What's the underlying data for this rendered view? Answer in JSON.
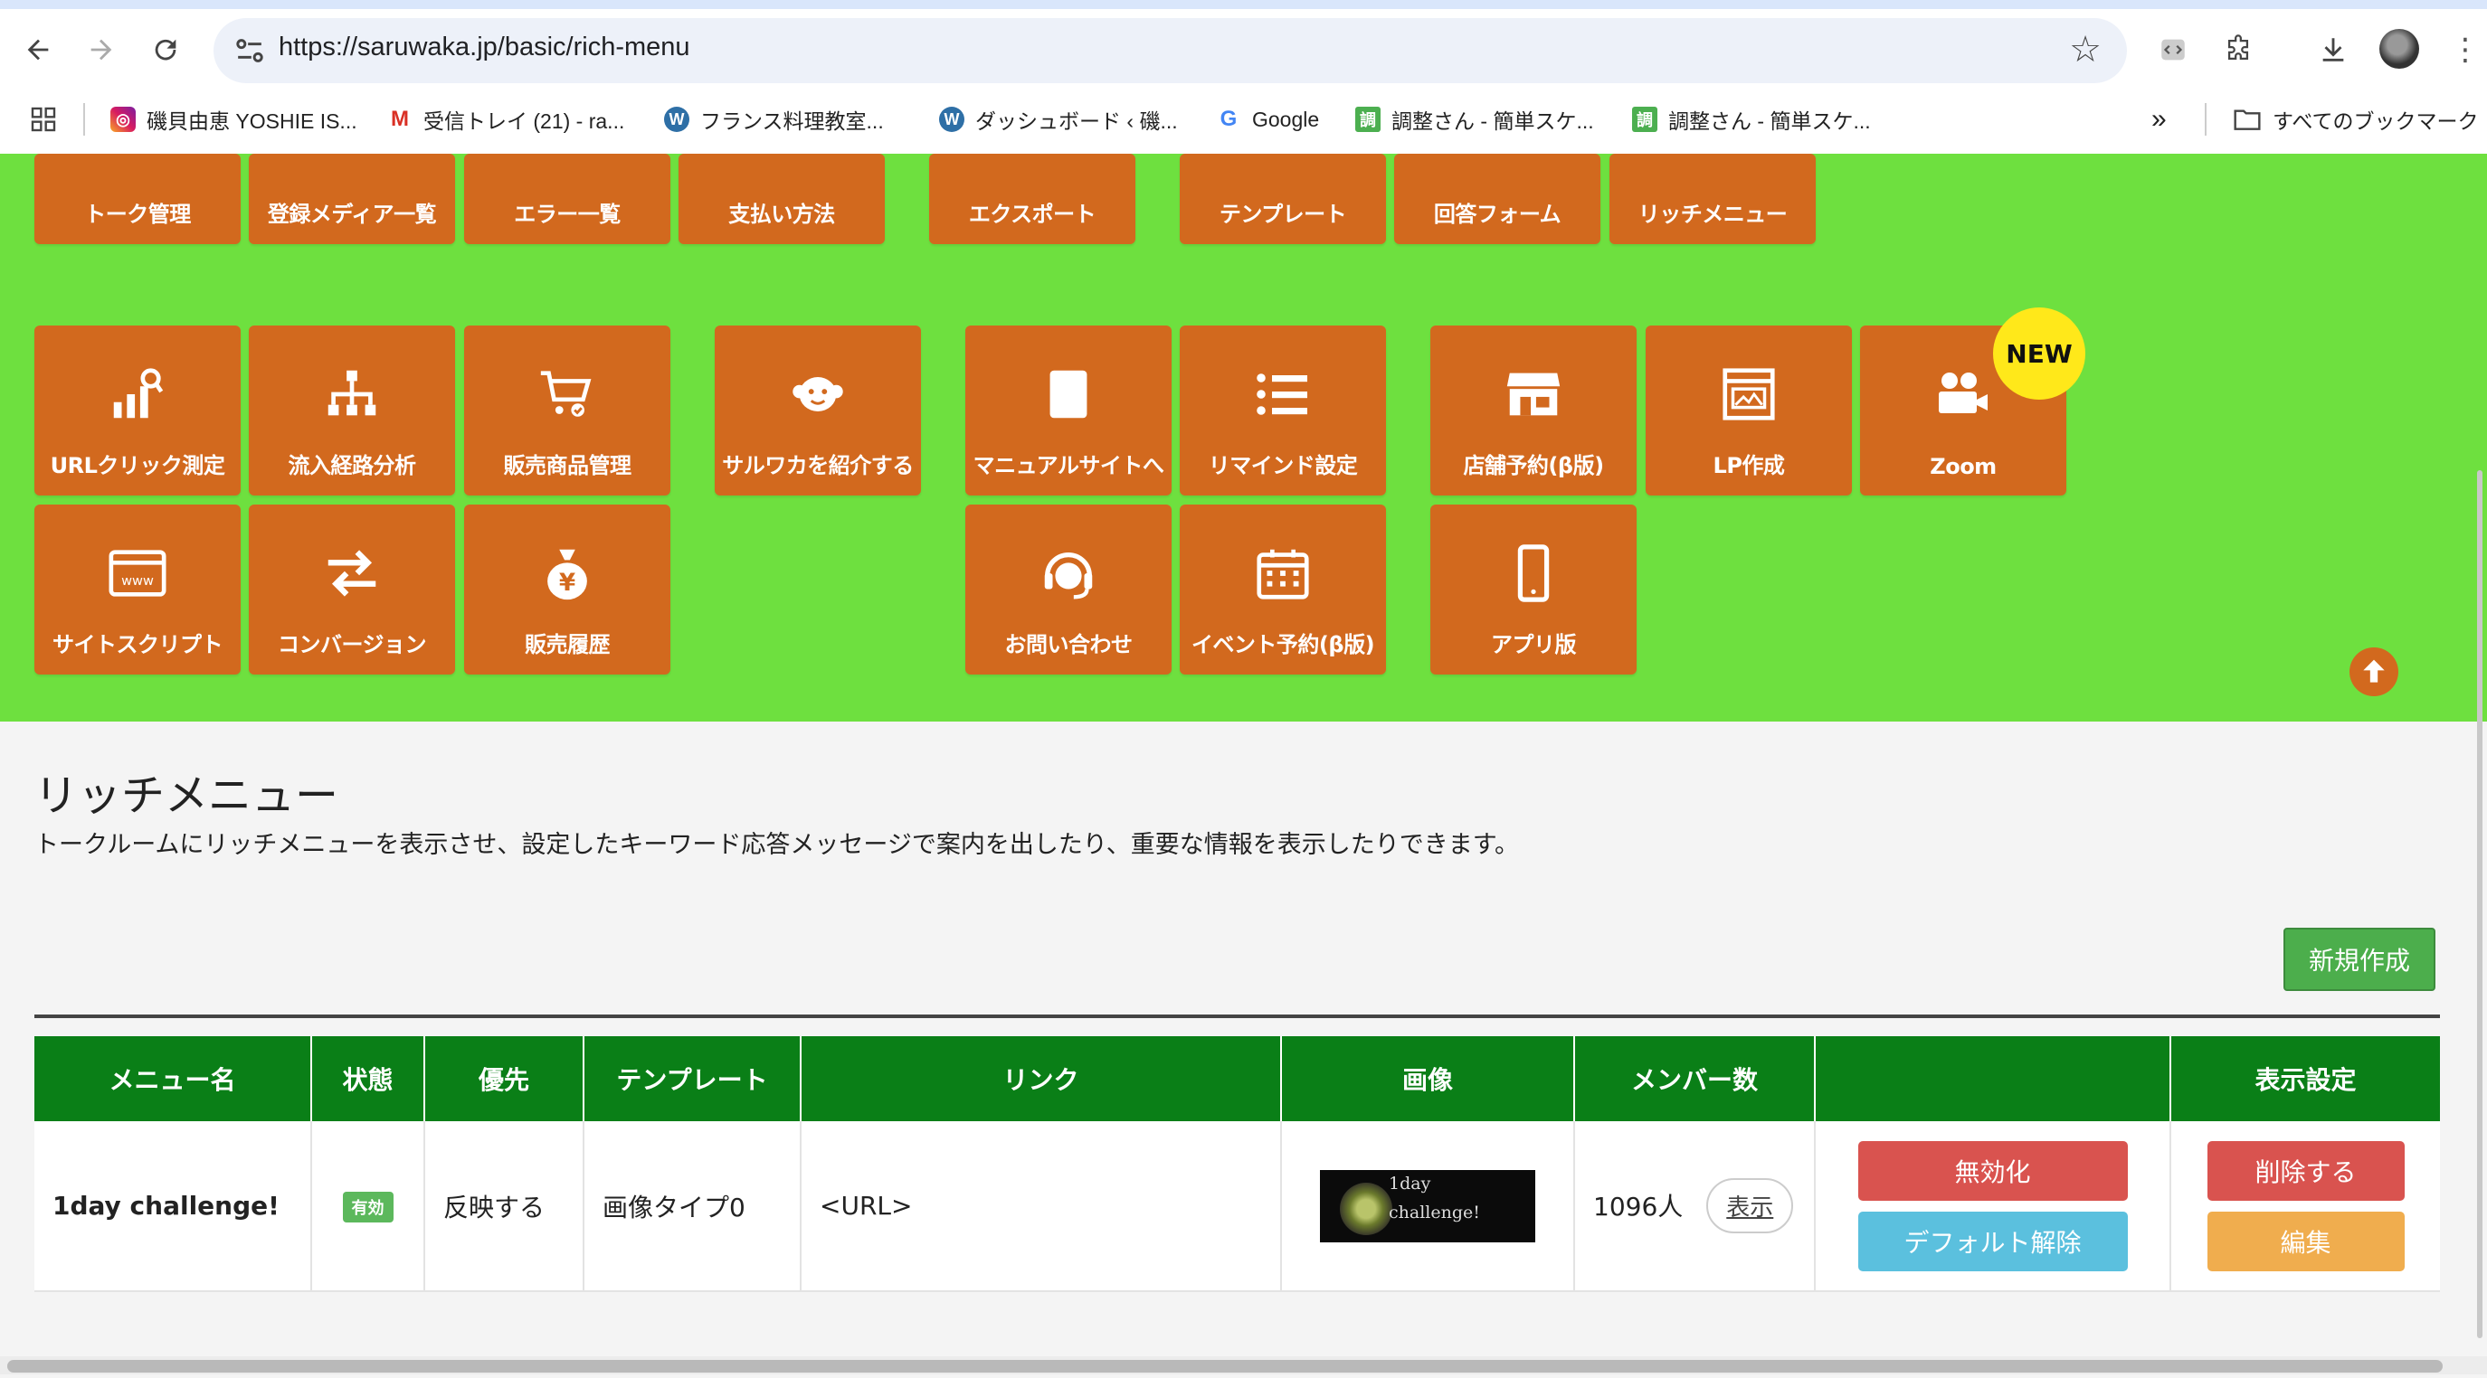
{
  "browser": {
    "url": "https://saruwaka.jp/basic/rich-menu",
    "bookmarks": [
      {
        "label": "磯貝由恵 YOSHIE IS...",
        "icon": "instagram-icon"
      },
      {
        "label": "受信トレイ (21) - ra...",
        "icon": "gmail-icon"
      },
      {
        "label": "フランス料理教室...",
        "icon": "wordpress-icon"
      },
      {
        "label": "ダッシュボード ‹ 磯...",
        "icon": "wordpress-icon"
      },
      {
        "label": "Google",
        "icon": "google-icon"
      },
      {
        "label": "調整さん - 簡単スケ...",
        "icon": "chouseisan-icon"
      },
      {
        "label": "調整さん - 簡単スケ...",
        "icon": "chouseisan-icon"
      }
    ],
    "more_bookmarks": "»",
    "all_bookmarks": "すべてのブックマーク"
  },
  "menu_tiles_top_row": [
    "トーク管理",
    "登録メディア一覧",
    "エラー一覧",
    "支払い方法",
    "エクスポート",
    "テンプレート",
    "回答フォーム",
    "リッチメニュー"
  ],
  "menu_tiles": {
    "url_click": "URLクリック測定",
    "inflow_route": "流入経路分析",
    "sales_products": "販売商品管理",
    "introduce": "サルワカを紹介する",
    "manual": "マニュアルサイトへ",
    "remind": "リマインド設定",
    "store_reservation": "店舗予約(β版)",
    "lp": "LP作成",
    "zoom": "Zoom",
    "site_script": "サイトスクリプト",
    "conversion": "コンバージョン",
    "sales_history": "販売履歴",
    "contact": "お問い合わせ",
    "event_reservation": "イベント予約(β版)",
    "app": "アプリ版",
    "new_badge": "NEW"
  },
  "page": {
    "title": "リッチメニュー",
    "description": "トークルームにリッチメニューを表示させ、設定したキーワード応答メッセージで案内を出したり、重要な情報を表示したりできます。",
    "new_button": "新規作成"
  },
  "table": {
    "headers": [
      "メニュー名",
      "状態",
      "優先",
      "テンプレート",
      "リンク",
      "画像",
      "メンバー数",
      "",
      "表示設定"
    ],
    "rows": [
      {
        "name": "1day challenge!",
        "status": "有効",
        "priority": "反映する",
        "template": "画像タイプ0",
        "link": "<URL>",
        "image_text_1": "1day",
        "image_text_2": "challenge!",
        "members": "1096人",
        "show_label": "表示",
        "disable_label": "無効化",
        "default_release_label": "デフォルト解除",
        "delete_label": "削除する",
        "edit_label": "編集"
      }
    ]
  },
  "colors": {
    "menu_background": "#6ee03f",
    "tile": "#d2691e",
    "table_header": "#0a7f17",
    "danger": "#d9534f",
    "info": "#5bc0de",
    "warning": "#f0ad4e",
    "success": "#4cae4c"
  }
}
